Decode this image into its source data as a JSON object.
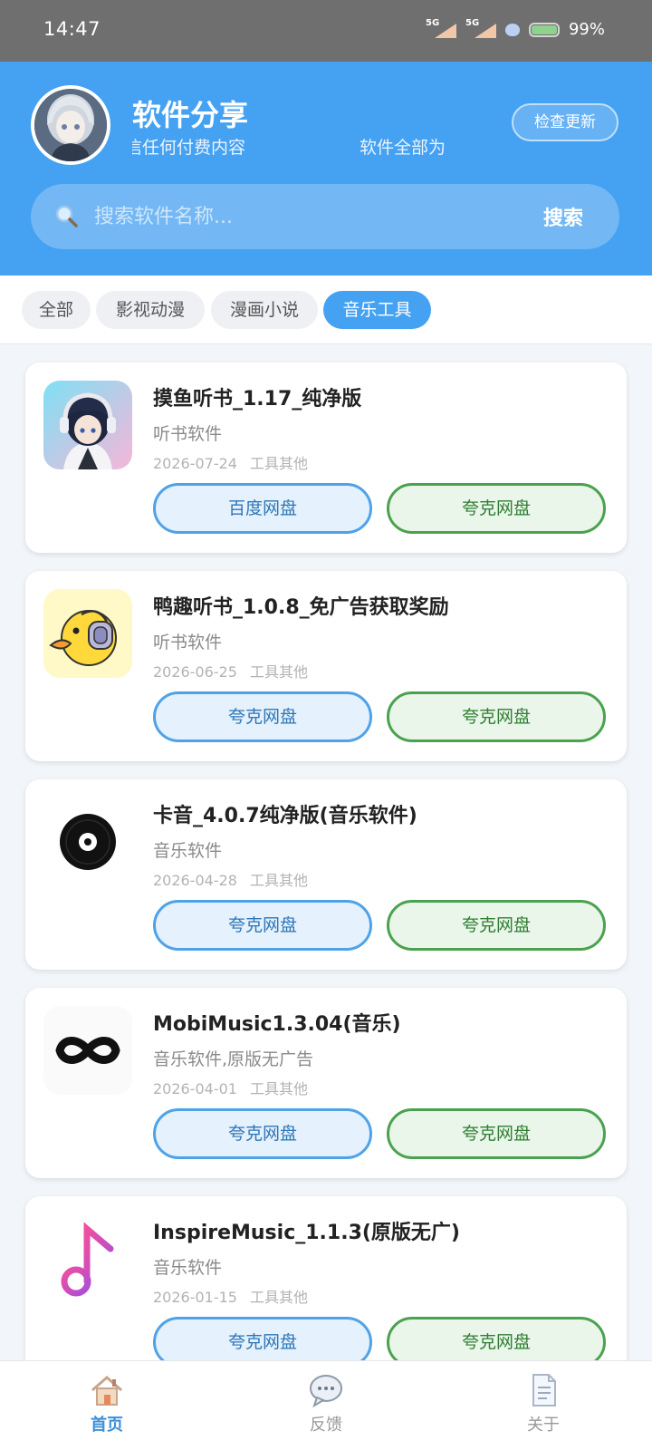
{
  "status_bar": {
    "time": "14:47",
    "signal1": "5G",
    "signal2": "5G",
    "battery": "99%"
  },
  "header": {
    "title": "软件分享",
    "marquee": "信任何付费内容 软件全部为",
    "update_button": "检查更新",
    "search_placeholder": "搜索软件名称...",
    "search_button": "搜索"
  },
  "tabs": [
    {
      "label": "全部",
      "active": false
    },
    {
      "label": "影视动漫",
      "active": false
    },
    {
      "label": "漫画小说",
      "active": false
    },
    {
      "label": "音乐工具",
      "active": true
    }
  ],
  "apps": [
    {
      "name": "摸鱼听书_1.17_纯净版",
      "desc": "听书软件",
      "date": "2026-07-24",
      "category": "工具其他",
      "btn1": "百度网盘",
      "btn2": "夸克网盘",
      "icon": "anime-headphones-icon"
    },
    {
      "name": "鸭趣听书_1.0.8_免广告获取奖励",
      "desc": "听书软件",
      "date": "2026-06-25",
      "category": "工具其他",
      "btn1": "夸克网盘",
      "btn2": "夸克网盘",
      "icon": "duck-headphones-icon"
    },
    {
      "name": "卡音_4.0.7纯净版(音乐软件)",
      "desc": "音乐软件",
      "date": "2026-04-28",
      "category": "工具其他",
      "btn1": "夸克网盘",
      "btn2": "夸克网盘",
      "icon": "vinyl-record-icon"
    },
    {
      "name": "MobiMusic1.3.04(音乐)",
      "desc": "音乐软件,原版无广告",
      "date": "2026-04-01",
      "category": "工具其他",
      "btn1": "夸克网盘",
      "btn2": "夸克网盘",
      "icon": "infinity-icon"
    },
    {
      "name": "InspireMusic_1.1.3(原版无广)",
      "desc": "音乐软件",
      "date": "2026-01-15",
      "category": "工具其他",
      "btn1": "夸克网盘",
      "btn2": "夸克网盘",
      "icon": "music-note-icon"
    }
  ],
  "bottom_nav": [
    {
      "label": "首页",
      "icon": "home-icon",
      "active": true
    },
    {
      "label": "反馈",
      "icon": "chat-bubble-icon",
      "active": false
    },
    {
      "label": "关于",
      "icon": "document-icon",
      "active": false
    }
  ],
  "colors": {
    "primary": "#45a1f2",
    "blue_btn": "#4ea3e8",
    "green_btn": "#4aa24e"
  }
}
